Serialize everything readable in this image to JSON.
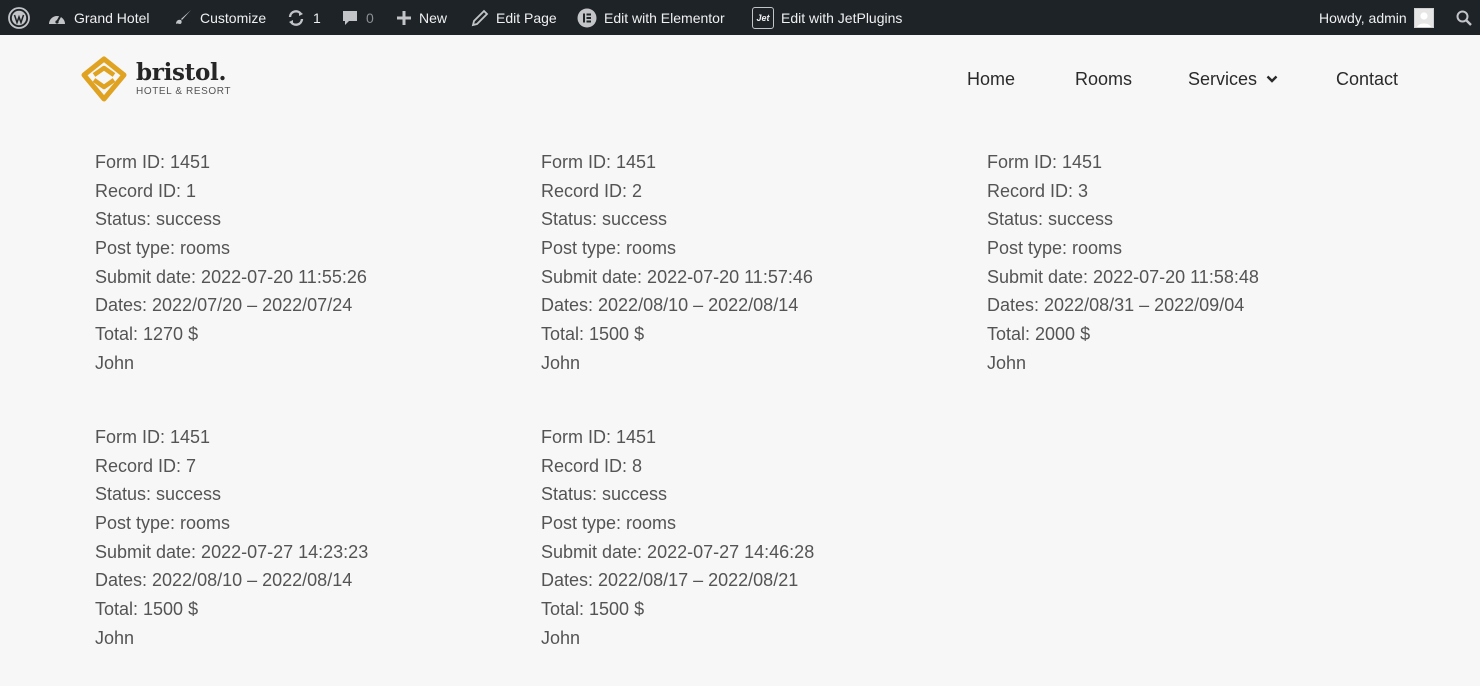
{
  "admin_bar": {
    "site_name": "Grand Hotel",
    "customize": "Customize",
    "updates_count": "1",
    "comments_count": "0",
    "new": "New",
    "edit_page": "Edit Page",
    "edit_elementor": "Edit with Elementor",
    "edit_jetplugins": "Edit with JetPlugins",
    "jet_badge": "Jet",
    "howdy": "Howdy, admin"
  },
  "header": {
    "logo_name": "bristol.",
    "logo_tagline": "HOTEL & RESORT",
    "nav": {
      "home": "Home",
      "rooms": "Rooms",
      "services": "Services",
      "contact": "Contact"
    },
    "accent_color": "#e0a321"
  },
  "records": [
    {
      "form_id": "Form ID: 1451",
      "record_id": "Record ID: 1",
      "status": "Status: success",
      "post_type": "Post type: rooms",
      "submit_date": "Submit date: 2022-07-20 11:55:26",
      "dates": "Dates: 2022/07/20 – 2022/07/24",
      "total": "Total: 1270 $",
      "name": "John"
    },
    {
      "form_id": "Form ID: 1451",
      "record_id": "Record ID: 2",
      "status": "Status: success",
      "post_type": "Post type: rooms",
      "submit_date": "Submit date: 2022-07-20 11:57:46",
      "dates": "Dates: 2022/08/10 – 2022/08/14",
      "total": "Total: 1500 $",
      "name": "John"
    },
    {
      "form_id": "Form ID: 1451",
      "record_id": "Record ID: 3",
      "status": "Status: success",
      "post_type": "Post type: rooms",
      "submit_date": "Submit date: 2022-07-20 11:58:48",
      "dates": "Dates: 2022/08/31 – 2022/09/04",
      "total": "Total: 2000 $",
      "name": "John"
    },
    {
      "form_id": "Form ID: 1451",
      "record_id": "Record ID: 7",
      "status": "Status: success",
      "post_type": "Post type: rooms",
      "submit_date": "Submit date: 2022-07-27 14:23:23",
      "dates": "Dates: 2022/08/10 – 2022/08/14",
      "total": "Total: 1500 $",
      "name": "John"
    },
    {
      "form_id": "Form ID: 1451",
      "record_id": "Record ID: 8",
      "status": "Status: success",
      "post_type": "Post type: rooms",
      "submit_date": "Submit date: 2022-07-27 14:46:28",
      "dates": "Dates: 2022/08/17 – 2022/08/21",
      "total": "Total: 1500 $",
      "name": "John"
    }
  ]
}
